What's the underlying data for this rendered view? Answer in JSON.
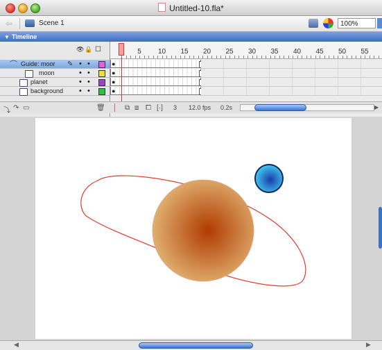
{
  "window": {
    "title": "Untitled-10.fla*"
  },
  "scene_bar": {
    "scene_label": "Scene 1",
    "zoom": "100%"
  },
  "timeline": {
    "header": "Timeline",
    "ruler": [
      "1",
      "5",
      "10",
      "15",
      "20",
      "25",
      "30",
      "35",
      "40",
      "45",
      "50",
      "55"
    ],
    "layers": [
      {
        "name": "Guide: moor",
        "type": "guide",
        "color": "#e060e0",
        "selected": true,
        "editing": true
      },
      {
        "name": "moon",
        "type": "guided",
        "color": "#e8e040",
        "selected": false
      },
      {
        "name": "planet",
        "type": "normal",
        "color": "#a040d0",
        "selected": false
      },
      {
        "name": "background",
        "type": "normal",
        "color": "#30c040",
        "selected": false
      }
    ],
    "footer": {
      "frame": "3",
      "fps": "12.0 fps",
      "time": "0.2s"
    }
  },
  "stage": {
    "planet_colors": {
      "center": "#b03a00",
      "edge": "#e0b070"
    },
    "moon_colors": {
      "center": "#1a3aa8",
      "edge": "#40c8f0"
    },
    "guide_color": "#e03a2a"
  }
}
